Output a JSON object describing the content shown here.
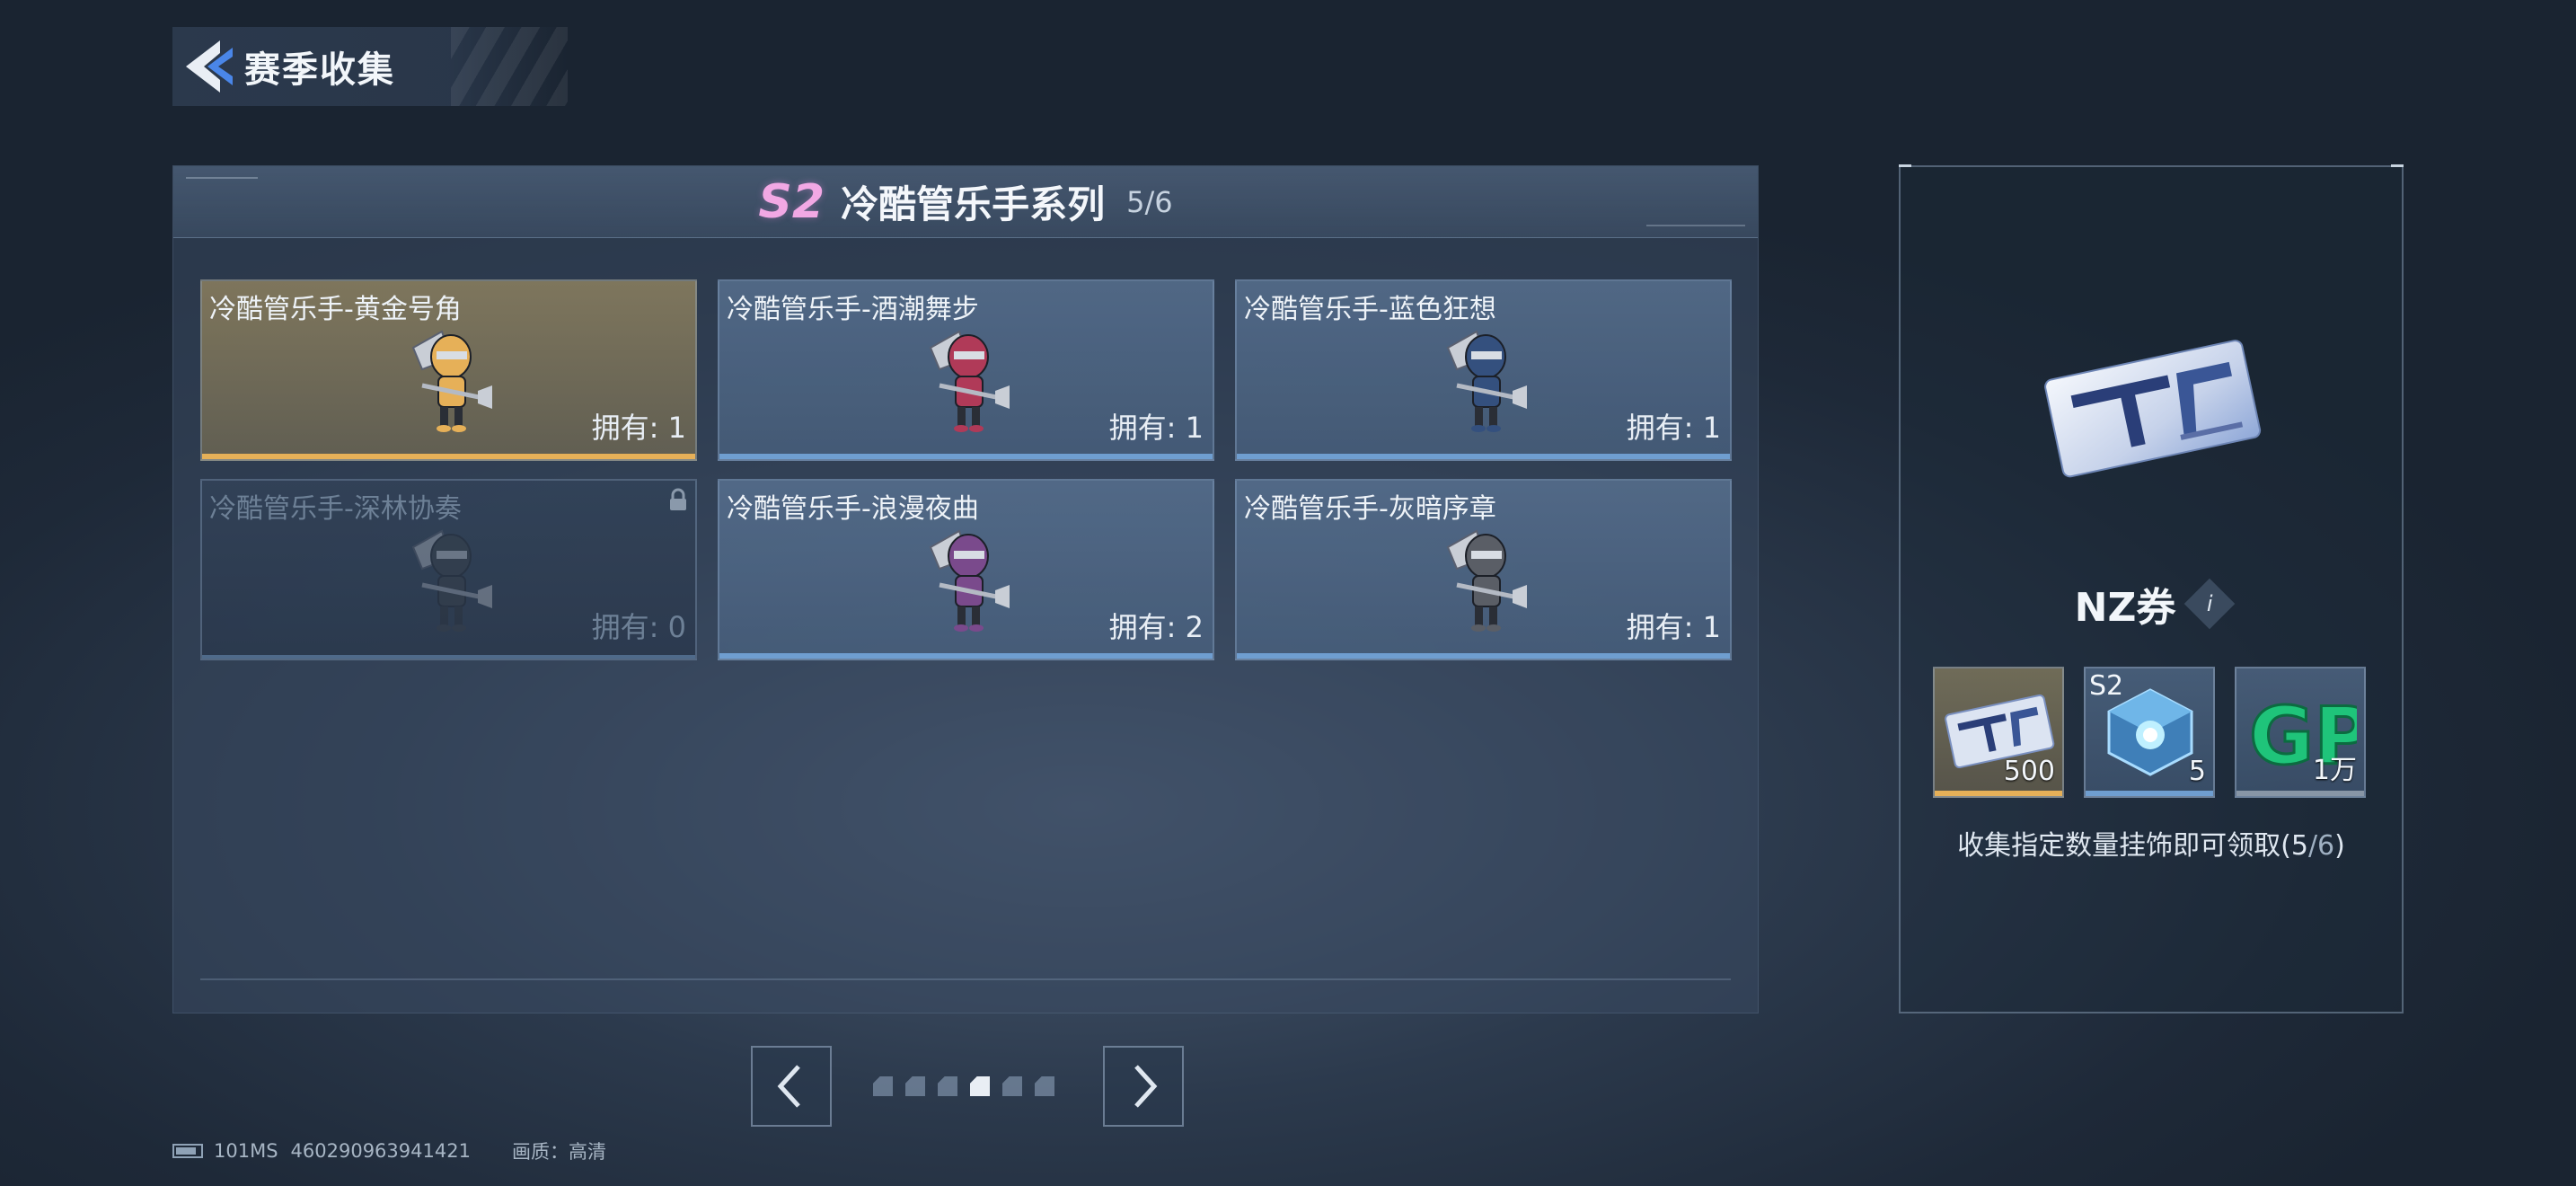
{
  "header": {
    "title": "赛季收集"
  },
  "series": {
    "badge": "S2",
    "name": "冷酷管乐手系列",
    "progress": "5/6"
  },
  "cards": [
    {
      "name": "冷酷管乐手-黄金号角",
      "owned": "拥有: 1",
      "style": "gold",
      "color": "#e6b058"
    },
    {
      "name": "冷酷管乐手-酒潮舞步",
      "owned": "拥有: 1",
      "style": "normal",
      "color": "#b03a58"
    },
    {
      "name": "冷酷管乐手-蓝色狂想",
      "owned": "拥有: 1",
      "style": "normal",
      "color": "#34507e"
    },
    {
      "name": "冷酷管乐手-深林协奏",
      "owned": "拥有: 0",
      "style": "locked",
      "color": "#3a3f45"
    },
    {
      "name": "冷酷管乐手-浪漫夜曲",
      "owned": "拥有: 2",
      "style": "normal",
      "color": "#7a4a8c"
    },
    {
      "name": "冷酷管乐手-灰暗序章",
      "owned": "拥有: 1",
      "style": "normal",
      "color": "#5a5e66"
    }
  ],
  "pager": {
    "total": 6,
    "active_index": 3
  },
  "status": {
    "ping": "101MS",
    "id": "460290963941421",
    "quality": "画质：高清"
  },
  "reward_panel": {
    "title": "NZ券",
    "items": [
      {
        "qty": "500",
        "icon": "nz-ticket-icon",
        "style": "gold"
      },
      {
        "tag": "S2",
        "qty": "5",
        "icon": "s2-crate-icon",
        "style": "blue"
      },
      {
        "qty": "1万",
        "icon": "gp-coin-icon",
        "style": "grey"
      }
    ],
    "desc_main": "收集指定数量挂饰即可领取(5",
    "desc_dim": "/6",
    "desc_end": ")"
  }
}
